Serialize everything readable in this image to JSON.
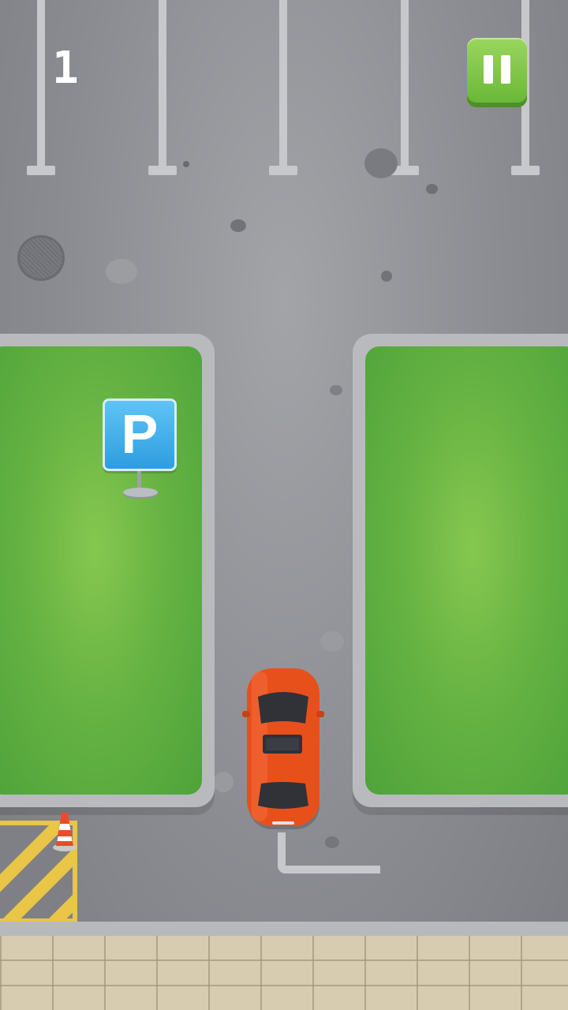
{
  "hud": {
    "score": "1",
    "pause_icon": "pause-icon"
  },
  "sign": {
    "letter": "P"
  },
  "colors": {
    "asphalt": "#8b8c91",
    "grass": "#67b343",
    "car": "#e8501b",
    "pause_button": "#7cc244",
    "sign": "#3aa8e8",
    "hazard_stripe": "#e9c548"
  }
}
